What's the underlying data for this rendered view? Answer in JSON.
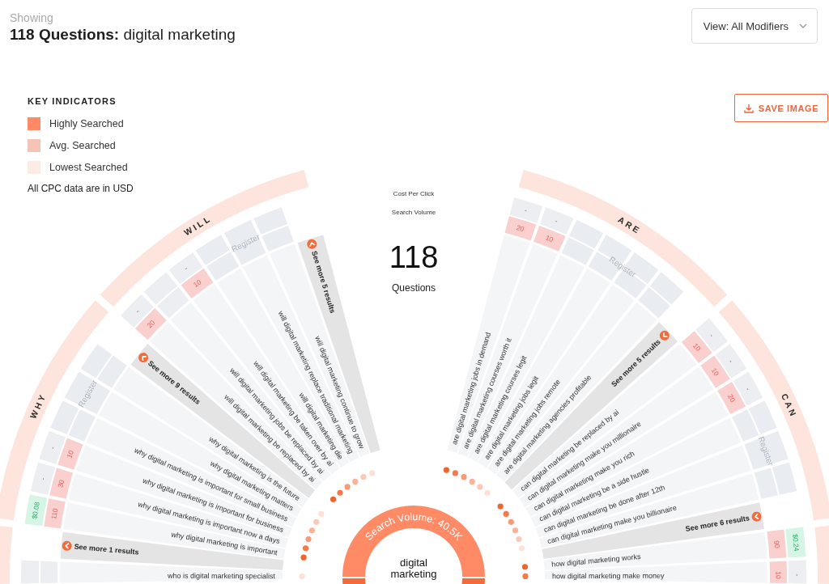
{
  "header": {
    "kicker": "Showing",
    "title": "**118 Questions:** digital marketing"
  },
  "view_menu": {
    "label": "View: All Modifiers"
  },
  "legend": {
    "title": "KEY INDICATORS",
    "items": [
      {
        "label": "Highly Searched",
        "color": "#ff8a65"
      },
      {
        "label": "Avg. Searched",
        "color": "#f6c4b7"
      },
      {
        "label": "Lowest Searched",
        "color": "#fdebe6"
      }
    ],
    "note": "All CPC data are in USD"
  },
  "save_button": {
    "label": "SAVE IMAGE"
  },
  "wheel": {
    "cpc_label": "Cost Per Click",
    "volume_label": "Search Volume",
    "total": "118",
    "total_label": "Questions",
    "hub": {
      "volume": "Search Volume: 40.5K",
      "keyword": "digital marketing"
    },
    "left_sections": [
      {
        "see_more": "See more 1 results",
        "questions": [
          {
            "text": "who is digital marketing specialist",
            "color": "#fde0d6"
          }
        ]
      },
      {
        "label": "WHY",
        "see_more": "See more 9 results",
        "questions": [
          {
            "text": "why digital marketing is important",
            "color": "#f0642f",
            "volume": "110",
            "cpc": {
              "value": "$0.08",
              "kind": "price"
            }
          },
          {
            "text": "why digital marketing is important now a days",
            "color": "#f4794b",
            "volume": "30",
            "cpc": {
              "value": "-",
              "kind": "blank"
            }
          },
          {
            "text": "why digital marketing is important for business",
            "color": "#f89a78",
            "volume": "10",
            "cpc": {
              "value": "-",
              "kind": "blank"
            }
          }
        ],
        "locked": {
          "label": "Register",
          "questions": [
            {
              "text": "why digital marketing is important for small business",
              "color": "#fab39a"
            },
            {
              "text": "why digital marketing matters",
              "color": "#fcc9b8"
            },
            {
              "text": "why digital marketing is the future",
              "color": "#fde0d6"
            }
          ]
        }
      },
      {
        "label": "WILL",
        "see_more": "See more 5 results",
        "questions": [
          {
            "text": "will digital marketing be replaced by ai",
            "color": "#f0642f",
            "volume": "20",
            "cpc": {
              "value": "-",
              "kind": "blank"
            }
          },
          {
            "text": "will digital marketing jobs be replaced by ai",
            "color": "#f4794b"
          },
          {
            "text": "will digital marketing be taken over by ai",
            "color": "#f89a78",
            "volume": "10",
            "cpc": {
              "value": "-",
              "kind": "blank"
            }
          }
        ],
        "locked": {
          "label": "Register",
          "questions": [
            {
              "text": "will digital marketing die",
              "color": "#fab39a"
            },
            {
              "text": "will digital marketing replace traditional marketing",
              "color": "#fcc9b8"
            },
            {
              "text": "will digital marketing continue to grow",
              "color": "#fde0d6"
            }
          ]
        }
      }
    ],
    "right_sections": [
      {
        "label": "ARE",
        "see_more": "See more 5 results",
        "questions": [
          {
            "text": "are digital marketing jobs in demand",
            "color": "#f0642f",
            "volume": "20",
            "cpc": {
              "value": "-",
              "kind": "blank"
            }
          },
          {
            "text": "are digital marketing courses worth it",
            "color": "#f4794b",
            "volume": "10",
            "cpc": {
              "value": "-",
              "kind": "blank"
            }
          }
        ],
        "locked": {
          "label": "Register",
          "questions": [
            {
              "text": "are digital marketing courses legit",
              "color": "#f89a78"
            },
            {
              "text": "are digital marketing jobs legit",
              "color": "#fab39a"
            },
            {
              "text": "are digital marketing jobs remote",
              "color": "#fcc9b8"
            },
            {
              "text": "are digital marketing agencies profitable",
              "color": "#fde0d6"
            }
          ]
        }
      },
      {
        "label": "CAN",
        "see_more": "See more 6 results",
        "questions": [
          {
            "text": "can digital marketing be replaced by ai",
            "color": "#f0642f",
            "volume": "10",
            "cpc": {
              "value": "-",
              "kind": "blank"
            }
          },
          {
            "text": "can digital marketing make you millionaire",
            "color": "#f4794b",
            "volume": "10",
            "cpc": {
              "value": "-",
              "kind": "blank"
            }
          },
          {
            "text": "can digital marketing make you rich",
            "color": "#f89a78",
            "volume": "20",
            "cpc": {
              "value": "-",
              "kind": "blank"
            }
          }
        ],
        "locked": {
          "label": "Register",
          "questions": [
            {
              "text": "can digital marketing be a side hustle",
              "color": "#fab39a"
            },
            {
              "text": "can digital marketing be done after 12th",
              "color": "#fcc9b8"
            },
            {
              "text": "can digital marketing make you billionaire",
              "color": "#fde0d6"
            }
          ]
        }
      },
      {
        "questions": [
          {
            "text": "how digital marketing works",
            "color": "#f0642f",
            "volume": "90",
            "cpc": {
              "value": "$0.24",
              "kind": "price"
            }
          },
          {
            "text": "how digital marketing make money",
            "color": "#f4794b",
            "volume": "10",
            "cpc": {
              "value": "-",
              "kind": "blank"
            }
          }
        ]
      }
    ]
  }
}
